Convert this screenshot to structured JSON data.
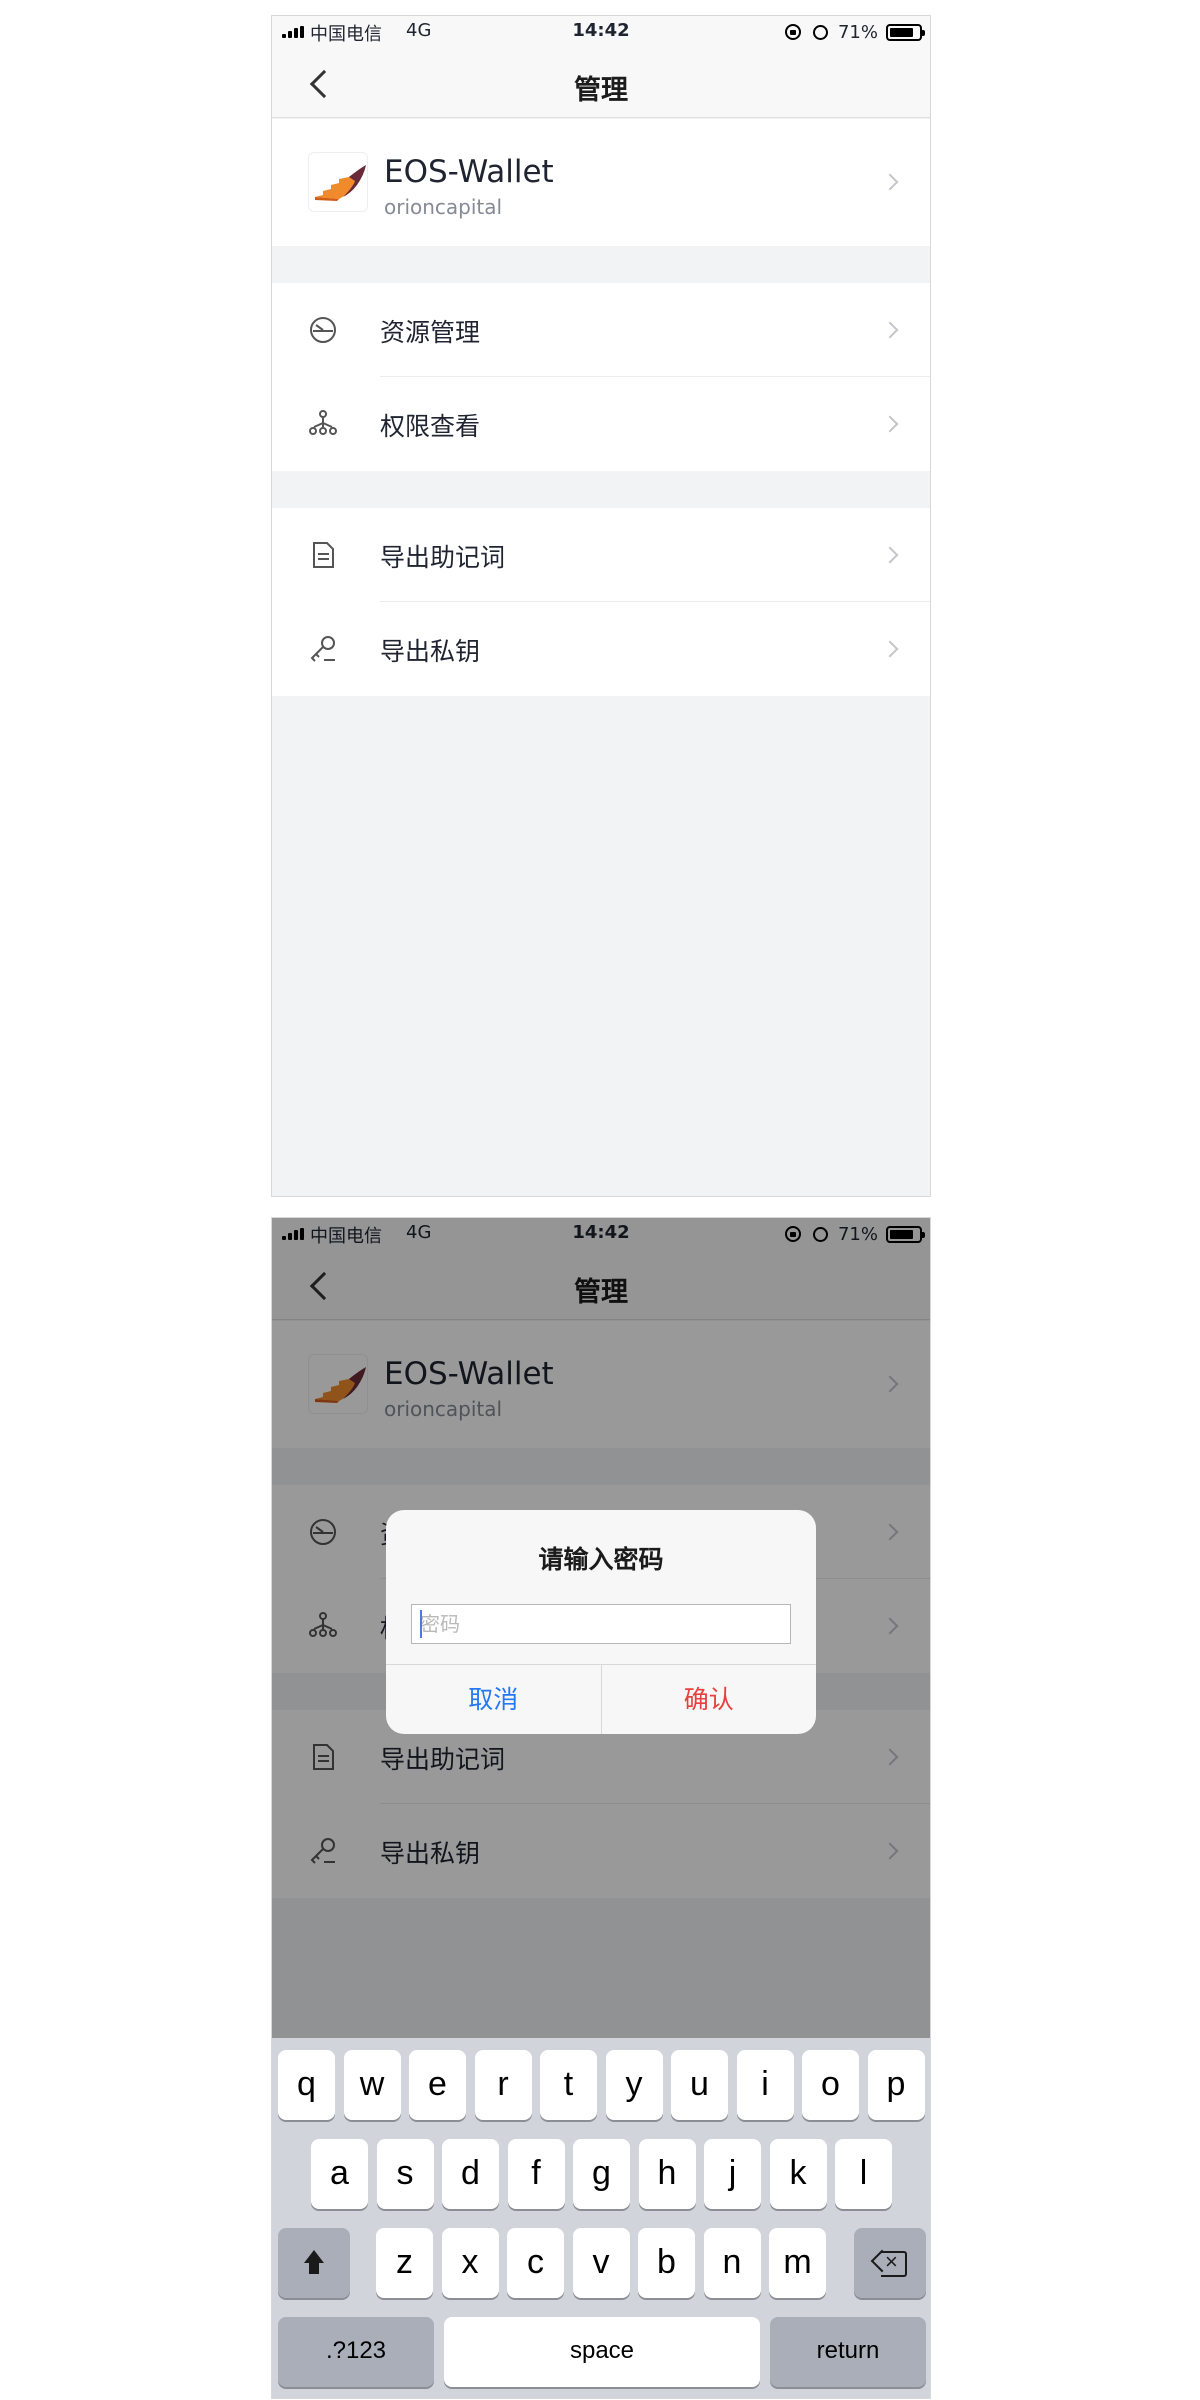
{
  "statusbar": {
    "carrier": "中国电信",
    "network": "4G",
    "time": "14:42",
    "battery": "71%",
    "battery_level": 0.71
  },
  "navbar": {
    "title": "管理"
  },
  "wallet": {
    "name": "EOS-Wallet",
    "account": "orioncapital"
  },
  "menu": {
    "resource_management": "资源管理",
    "permission_view": "权限查看",
    "export_mnemonic": "导出助记词",
    "export_private_key": "导出私钥"
  },
  "dialog": {
    "title": "请输入密码",
    "password_placeholder": "密码",
    "cancel_label": "取消",
    "confirm_label": "确认",
    "cancel_color": "#2479f3",
    "confirm_color": "#e8403b"
  },
  "keyboard": {
    "row1": [
      "q",
      "w",
      "e",
      "r",
      "t",
      "y",
      "u",
      "i",
      "o",
      "p"
    ],
    "row2": [
      "a",
      "s",
      "d",
      "f",
      "g",
      "h",
      "j",
      "k",
      "l"
    ],
    "row3": [
      "z",
      "x",
      "c",
      "v",
      "b",
      "n",
      "m"
    ],
    "numbers_label": ".?123",
    "space_label": "space",
    "return_label": "return"
  }
}
